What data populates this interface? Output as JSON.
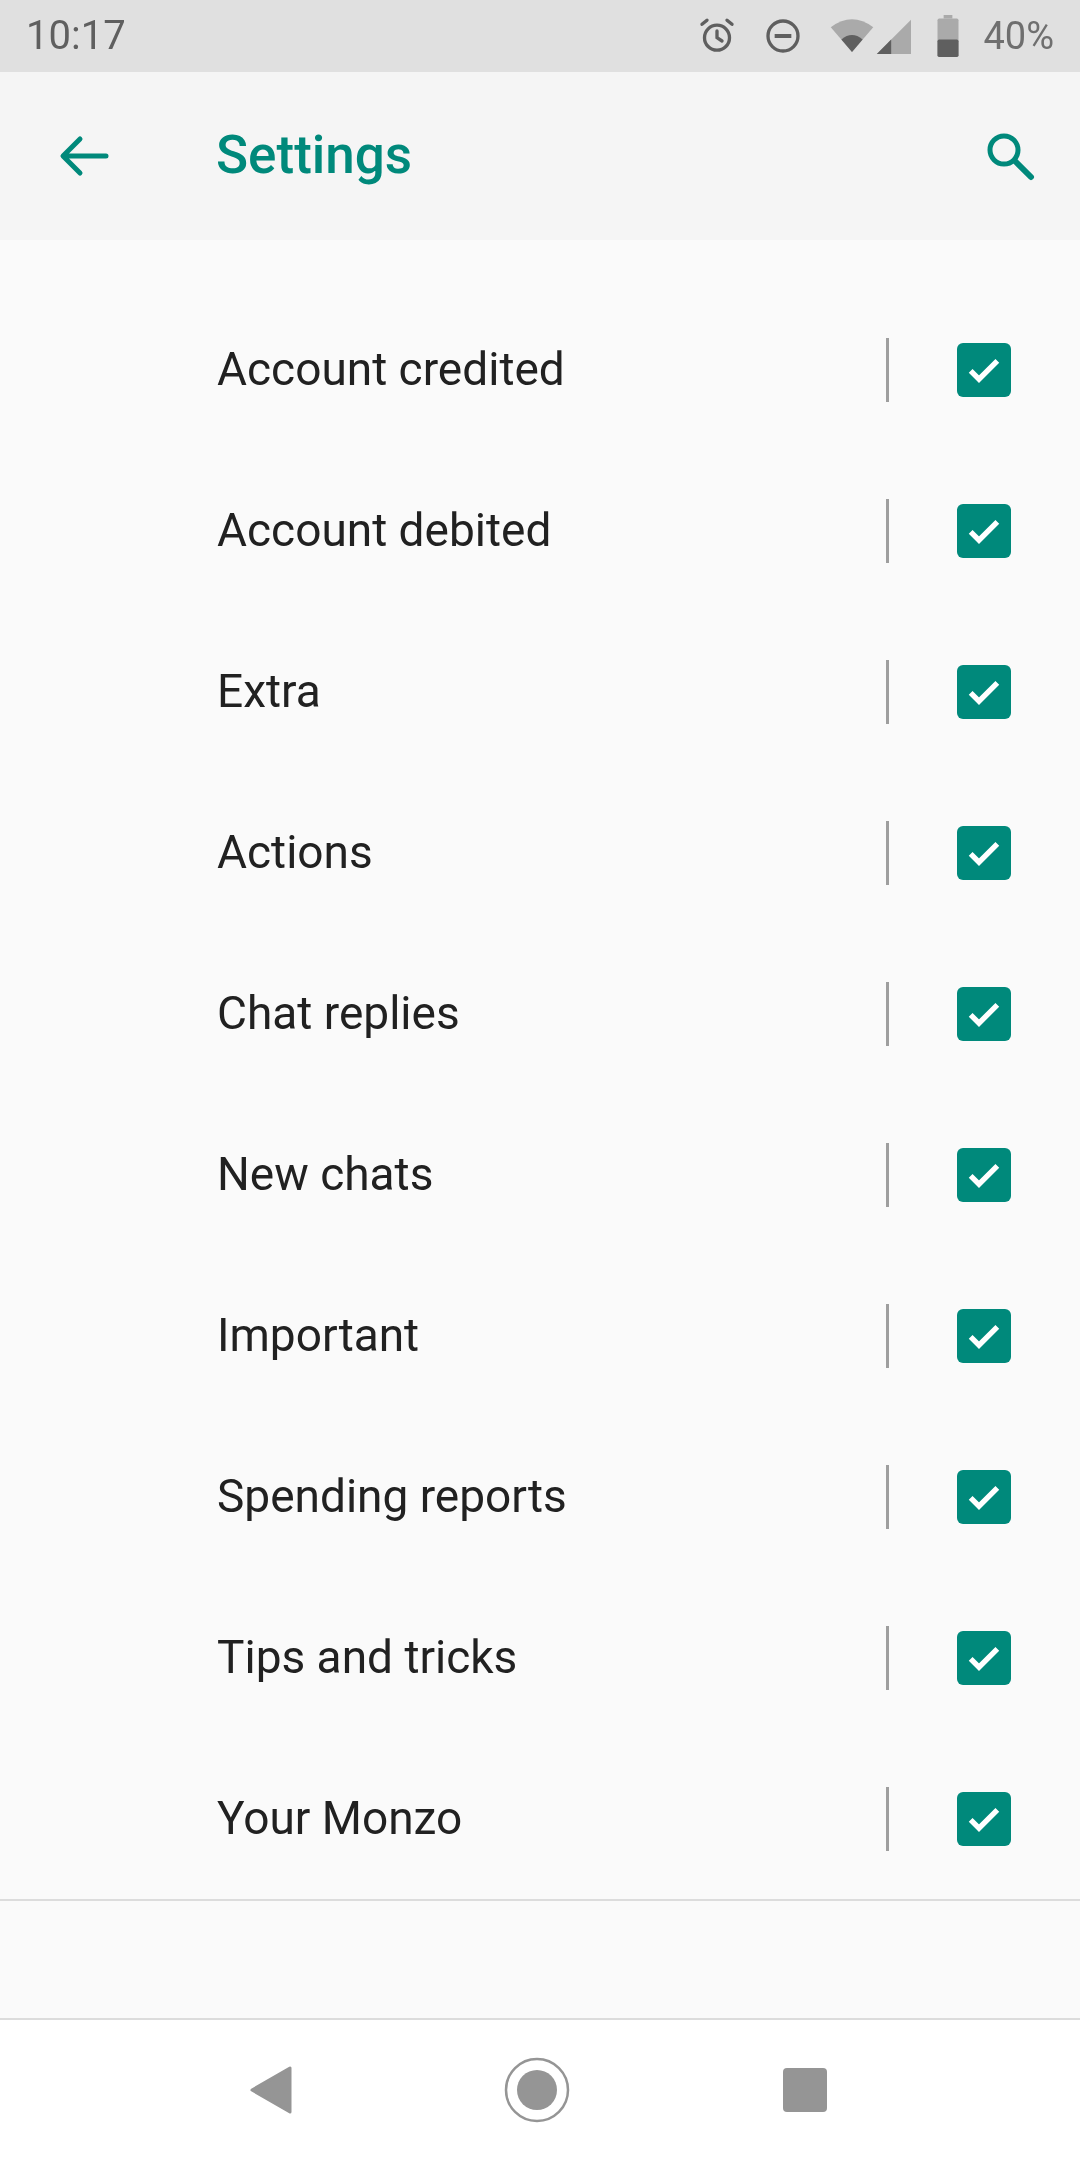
{
  "status_bar": {
    "time": "10:17",
    "battery": "40%"
  },
  "app_bar": {
    "title": "Settings"
  },
  "settings": [
    {
      "label": "Account credited",
      "checked": true
    },
    {
      "label": "Account debited",
      "checked": true
    },
    {
      "label": "Extra",
      "checked": true
    },
    {
      "label": "Actions",
      "checked": true
    },
    {
      "label": "Chat replies",
      "checked": true
    },
    {
      "label": "New chats",
      "checked": true
    },
    {
      "label": "Important",
      "checked": true
    },
    {
      "label": "Spending reports",
      "checked": true
    },
    {
      "label": "Tips and tricks",
      "checked": true
    },
    {
      "label": "Your Monzo",
      "checked": true
    }
  ]
}
